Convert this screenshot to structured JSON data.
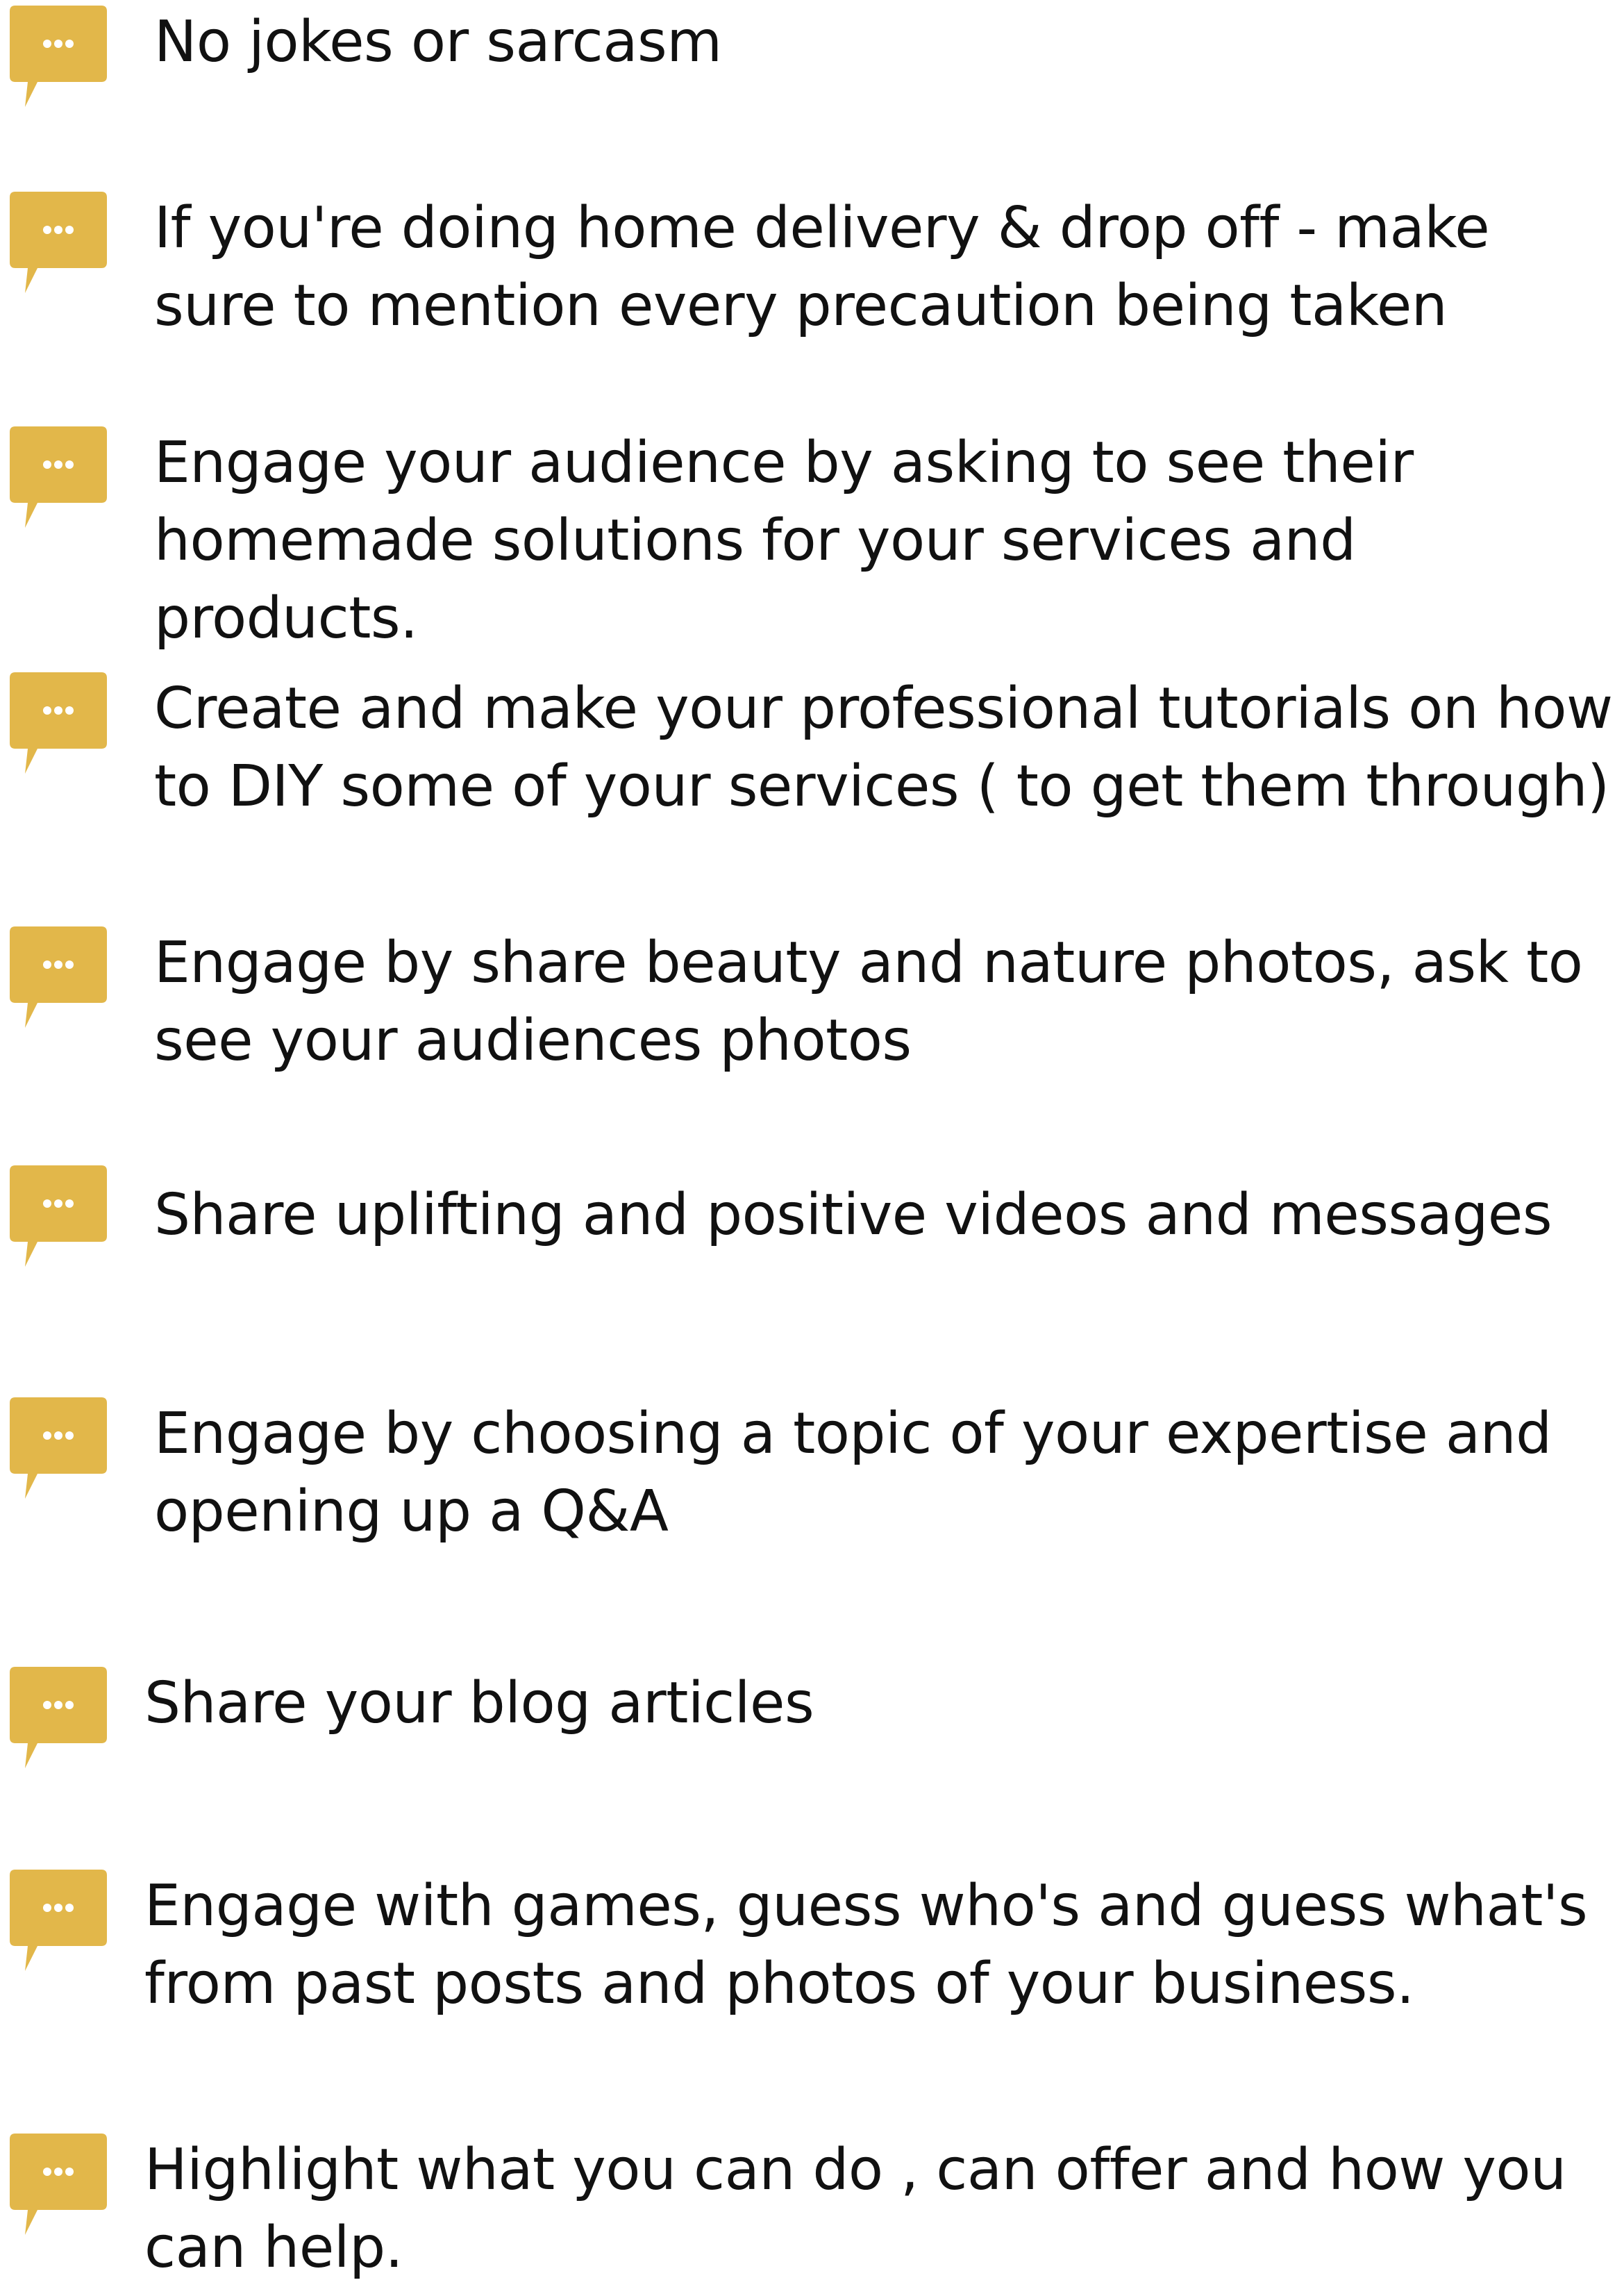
{
  "accent_color": "#e2b74a",
  "icon": "speech-bubble-ellipsis-icon",
  "items": [
    {
      "text": "No jokes or sarcasm"
    },
    {
      "text": "If you're doing home delivery & drop off - make\nsure to mention every precaution being taken"
    },
    {
      "text": "Engage your audience by asking to see their\nhomemade solutions for your services and products."
    },
    {
      "text": "Create and make your professional tutorials on how\nto DIY some of your services ( to get them through)"
    },
    {
      "text": "Engage by share beauty and nature photos, ask to\nsee your audiences photos"
    },
    {
      "text": "Share uplifting and positive videos and messages"
    },
    {
      "text": "Engage by choosing a topic of your expertise and\nopening up a Q&A"
    },
    {
      "text": "Share your blog articles"
    },
    {
      "text": "Engage with games, guess who's and guess what's\nfrom past posts and photos of your business."
    },
    {
      "text": "Highlight what you can do , can offer and how you\ncan help."
    }
  ]
}
